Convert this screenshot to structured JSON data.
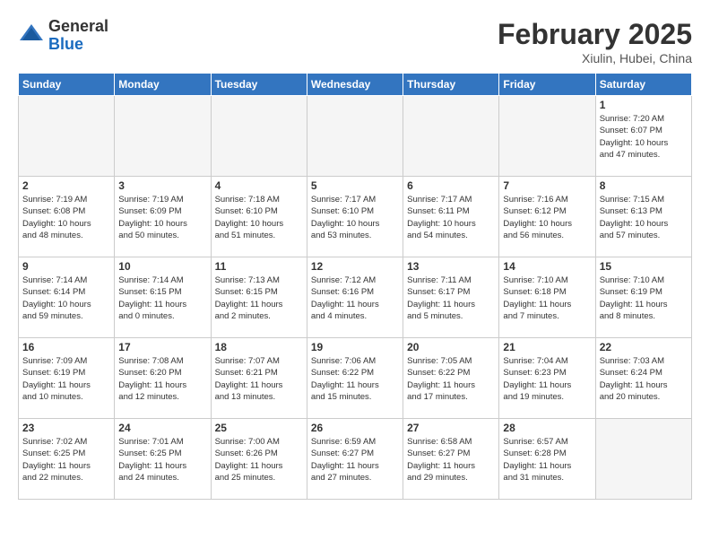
{
  "header": {
    "logo_general": "General",
    "logo_blue": "Blue",
    "month_title": "February 2025",
    "location": "Xiulin, Hubei, China"
  },
  "days_of_week": [
    "Sunday",
    "Monday",
    "Tuesday",
    "Wednesday",
    "Thursday",
    "Friday",
    "Saturday"
  ],
  "weeks": [
    [
      {
        "day": "",
        "info": ""
      },
      {
        "day": "",
        "info": ""
      },
      {
        "day": "",
        "info": ""
      },
      {
        "day": "",
        "info": ""
      },
      {
        "day": "",
        "info": ""
      },
      {
        "day": "",
        "info": ""
      },
      {
        "day": "1",
        "info": "Sunrise: 7:20 AM\nSunset: 6:07 PM\nDaylight: 10 hours\nand 47 minutes."
      }
    ],
    [
      {
        "day": "2",
        "info": "Sunrise: 7:19 AM\nSunset: 6:08 PM\nDaylight: 10 hours\nand 48 minutes."
      },
      {
        "day": "3",
        "info": "Sunrise: 7:19 AM\nSunset: 6:09 PM\nDaylight: 10 hours\nand 50 minutes."
      },
      {
        "day": "4",
        "info": "Sunrise: 7:18 AM\nSunset: 6:10 PM\nDaylight: 10 hours\nand 51 minutes."
      },
      {
        "day": "5",
        "info": "Sunrise: 7:17 AM\nSunset: 6:10 PM\nDaylight: 10 hours\nand 53 minutes."
      },
      {
        "day": "6",
        "info": "Sunrise: 7:17 AM\nSunset: 6:11 PM\nDaylight: 10 hours\nand 54 minutes."
      },
      {
        "day": "7",
        "info": "Sunrise: 7:16 AM\nSunset: 6:12 PM\nDaylight: 10 hours\nand 56 minutes."
      },
      {
        "day": "8",
        "info": "Sunrise: 7:15 AM\nSunset: 6:13 PM\nDaylight: 10 hours\nand 57 minutes."
      }
    ],
    [
      {
        "day": "9",
        "info": "Sunrise: 7:14 AM\nSunset: 6:14 PM\nDaylight: 10 hours\nand 59 minutes."
      },
      {
        "day": "10",
        "info": "Sunrise: 7:14 AM\nSunset: 6:15 PM\nDaylight: 11 hours\nand 0 minutes."
      },
      {
        "day": "11",
        "info": "Sunrise: 7:13 AM\nSunset: 6:15 PM\nDaylight: 11 hours\nand 2 minutes."
      },
      {
        "day": "12",
        "info": "Sunrise: 7:12 AM\nSunset: 6:16 PM\nDaylight: 11 hours\nand 4 minutes."
      },
      {
        "day": "13",
        "info": "Sunrise: 7:11 AM\nSunset: 6:17 PM\nDaylight: 11 hours\nand 5 minutes."
      },
      {
        "day": "14",
        "info": "Sunrise: 7:10 AM\nSunset: 6:18 PM\nDaylight: 11 hours\nand 7 minutes."
      },
      {
        "day": "15",
        "info": "Sunrise: 7:10 AM\nSunset: 6:19 PM\nDaylight: 11 hours\nand 8 minutes."
      }
    ],
    [
      {
        "day": "16",
        "info": "Sunrise: 7:09 AM\nSunset: 6:19 PM\nDaylight: 11 hours\nand 10 minutes."
      },
      {
        "day": "17",
        "info": "Sunrise: 7:08 AM\nSunset: 6:20 PM\nDaylight: 11 hours\nand 12 minutes."
      },
      {
        "day": "18",
        "info": "Sunrise: 7:07 AM\nSunset: 6:21 PM\nDaylight: 11 hours\nand 13 minutes."
      },
      {
        "day": "19",
        "info": "Sunrise: 7:06 AM\nSunset: 6:22 PM\nDaylight: 11 hours\nand 15 minutes."
      },
      {
        "day": "20",
        "info": "Sunrise: 7:05 AM\nSunset: 6:22 PM\nDaylight: 11 hours\nand 17 minutes."
      },
      {
        "day": "21",
        "info": "Sunrise: 7:04 AM\nSunset: 6:23 PM\nDaylight: 11 hours\nand 19 minutes."
      },
      {
        "day": "22",
        "info": "Sunrise: 7:03 AM\nSunset: 6:24 PM\nDaylight: 11 hours\nand 20 minutes."
      }
    ],
    [
      {
        "day": "23",
        "info": "Sunrise: 7:02 AM\nSunset: 6:25 PM\nDaylight: 11 hours\nand 22 minutes."
      },
      {
        "day": "24",
        "info": "Sunrise: 7:01 AM\nSunset: 6:25 PM\nDaylight: 11 hours\nand 24 minutes."
      },
      {
        "day": "25",
        "info": "Sunrise: 7:00 AM\nSunset: 6:26 PM\nDaylight: 11 hours\nand 25 minutes."
      },
      {
        "day": "26",
        "info": "Sunrise: 6:59 AM\nSunset: 6:27 PM\nDaylight: 11 hours\nand 27 minutes."
      },
      {
        "day": "27",
        "info": "Sunrise: 6:58 AM\nSunset: 6:27 PM\nDaylight: 11 hours\nand 29 minutes."
      },
      {
        "day": "28",
        "info": "Sunrise: 6:57 AM\nSunset: 6:28 PM\nDaylight: 11 hours\nand 31 minutes."
      },
      {
        "day": "",
        "info": ""
      }
    ]
  ]
}
